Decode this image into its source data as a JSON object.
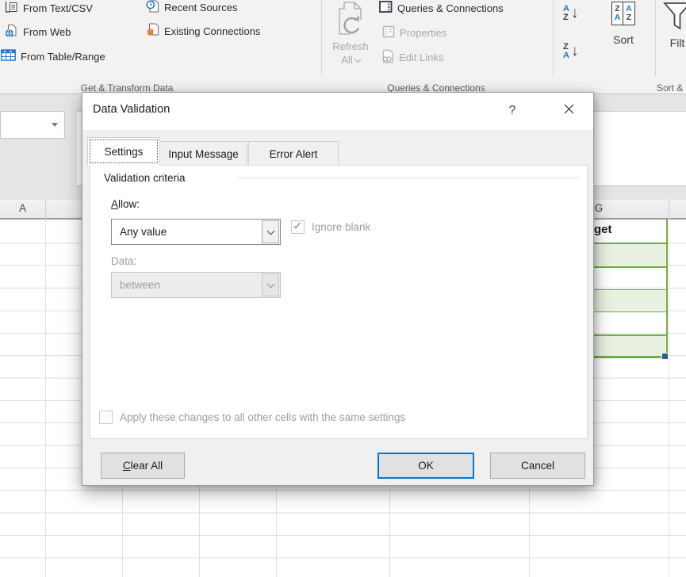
{
  "colors": {
    "accent_blue": "#0078d7",
    "range_border_green": "#6fae46",
    "range_fill_green": "#e9f1e1",
    "icon_blue": "#2079c6",
    "icon_orange": "#e8812d"
  },
  "ribbon": {
    "from_text_csv": "From Text/CSV",
    "from_web": "From Web",
    "from_table_range": "From Table/Range",
    "recent_sources": "Recent Sources",
    "existing_connections": "Existing Connections",
    "refresh_line1": "Refresh",
    "refresh_line2": "All",
    "queries_connections": "Queries & Connections",
    "properties": "Properties",
    "edit_links": "Edit Links",
    "sort_label": "Sort",
    "filter_label": "Filt",
    "letters": {
      "a": "A",
      "z": "Z"
    },
    "group_labels": {
      "get_transform": "Get & Transform Data",
      "queries": "Queries & Connections",
      "sort_filter": "Sort &"
    }
  },
  "formula_bar": {
    "name_box_value": ""
  },
  "sheet": {
    "col_a": "A",
    "col_g": "G",
    "budget_visible": "get"
  },
  "dialog": {
    "title": "Data Validation",
    "help_glyph": "?",
    "tabs": [
      {
        "label": "Settings",
        "active": true
      },
      {
        "label": "Input Message",
        "active": false
      },
      {
        "label": "Error Alert",
        "active": false
      }
    ],
    "settings": {
      "section_title": "Validation criteria",
      "allow_accel": "A",
      "allow_rest": "llow:",
      "allow_value": "Any value",
      "ignore_blank_label": "Ignore blank",
      "ignore_blank_checked": true,
      "data_label": "Data:",
      "data_value": "between",
      "apply_label": "Apply these changes to all other cells with the same settings",
      "apply_checked": false
    },
    "buttons": {
      "clear_accel": "C",
      "clear_rest": "lear All",
      "ok": "OK",
      "cancel": "Cancel"
    }
  }
}
